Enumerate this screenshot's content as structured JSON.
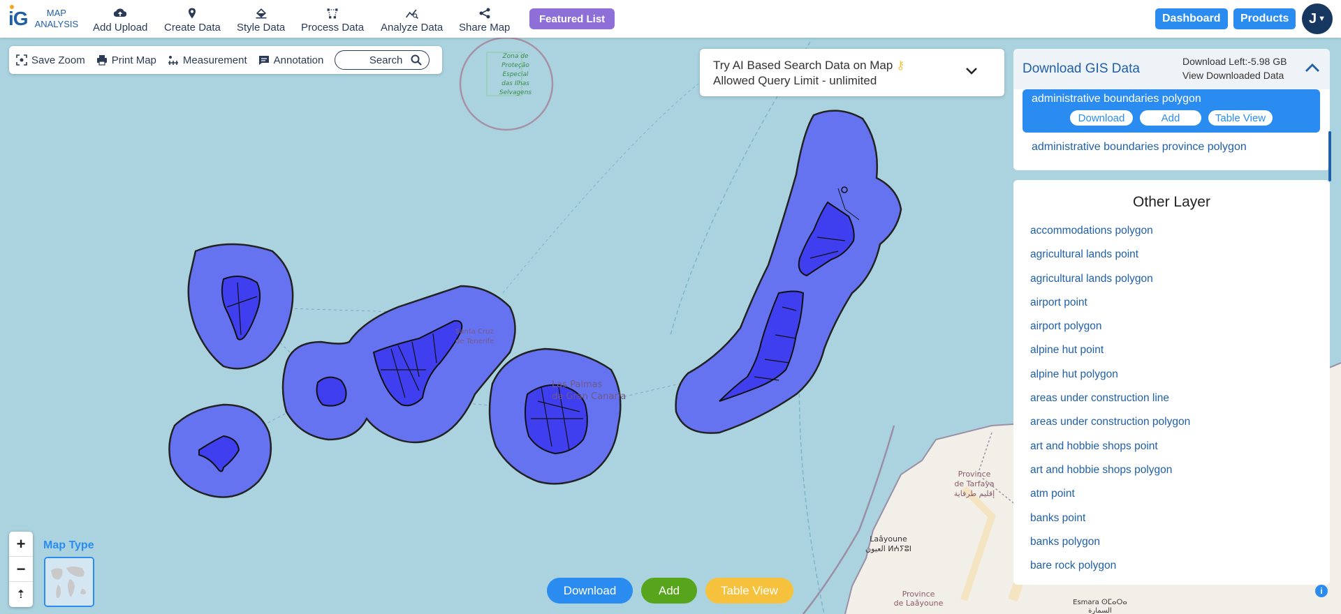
{
  "brand": {
    "logo_text": "iG",
    "line1": "MAP",
    "line2": "ANALYSIS"
  },
  "nav": {
    "items": [
      {
        "label": "Add Upload",
        "icon": "cloud-upload-icon"
      },
      {
        "label": "Create Data",
        "icon": "map-pin-icon"
      },
      {
        "label": "Style Data",
        "icon": "paint-bucket-icon"
      },
      {
        "label": "Process Data",
        "icon": "process-nodes-icon"
      },
      {
        "label": "Analyze Data",
        "icon": "analyze-chart-icon"
      },
      {
        "label": "Share Map",
        "icon": "share-icon"
      }
    ],
    "featured": "Featured List",
    "dashboard": "Dashboard",
    "products": "Products",
    "avatar_initial": "J"
  },
  "toolbar": {
    "save_zoom": "Save Zoom",
    "print_map": "Print Map",
    "measurement": "Measurement",
    "annotation": "Annotation",
    "search": "Search"
  },
  "ai_search": {
    "line1": "Try AI Based Search Data on Map",
    "line2": "Allowed Query Limit - unlimited"
  },
  "gis_panel": {
    "title": "Download GIS Data",
    "download_left": "Download Left:-5.98 GB",
    "view_downloaded": "View Downloaded Data",
    "selected_layer": "administrative boundaries polygon",
    "selected_actions": {
      "download": "Download",
      "add": "Add",
      "table_view": "Table View"
    },
    "second_layer": "administrative boundaries province polygon"
  },
  "other_layer": {
    "title": "Other Layer",
    "items": [
      "accommodations polygon",
      "agricultural lands point",
      "agricultural lands polygon",
      "airport point",
      "airport polygon",
      "alpine hut point",
      "alpine hut polygon",
      "areas under construction line",
      "areas under construction polygon",
      "art and hobbie shops point",
      "art and hobbie shops polygon",
      "atm point",
      "banks point",
      "banks polygon",
      "bare rock polygon"
    ]
  },
  "map": {
    "labels": {
      "zona": [
        "Zona de",
        "Proteção",
        "Especial",
        "das Ilhas",
        "Selvagens"
      ],
      "tenerife": [
        "Santa Cruz",
        "de Tenerife"
      ],
      "las_palmas": [
        "Las Palmas",
        "de Gran Canaria"
      ],
      "tarfaya": [
        "Province",
        "de Tarfaya",
        "إقليم طرفاية"
      ],
      "laayoune": [
        "Laâyoune",
        "العيون ⵍⵄⵢⵓⵏ"
      ],
      "prov_laayoune": [
        "Province",
        "de Laâyoune"
      ],
      "esmara": [
        "Esmara ⵙⵎⴰⵔⴰ",
        "السمارة"
      ]
    },
    "colors": {
      "sea": "#aad3df",
      "polygon_fill": "#6673f0",
      "land": "#f2efe9",
      "accent": "#2a8cf0"
    }
  },
  "map_controls": {
    "zoom_in": "+",
    "zoom_out": "−",
    "reset": "⇡",
    "map_type": "Map Type",
    "info": "i"
  },
  "bottom_actions": {
    "download": "Download",
    "add": "Add",
    "table_view": "Table View"
  }
}
